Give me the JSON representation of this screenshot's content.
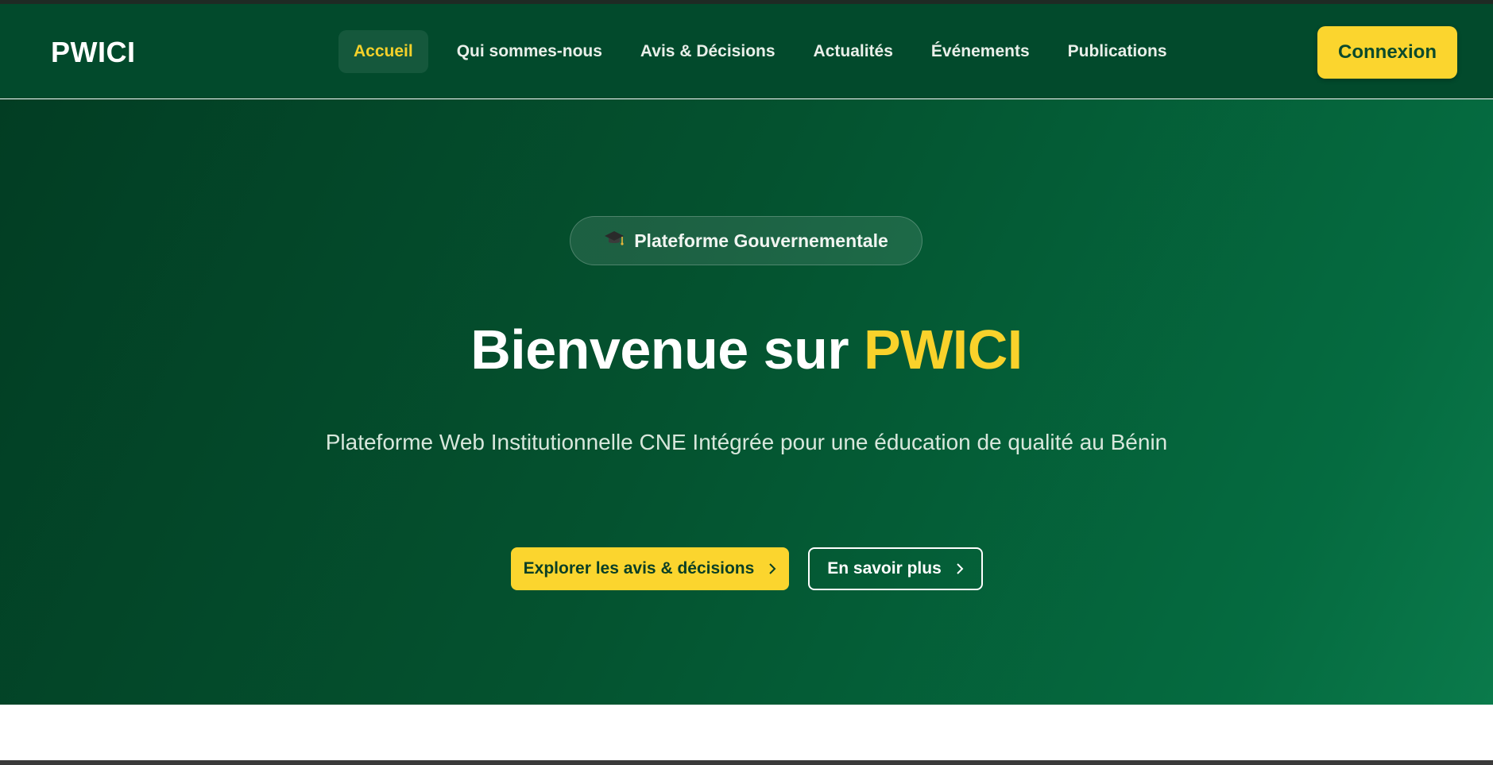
{
  "brand": {
    "logo": "PWICI"
  },
  "nav": {
    "items": [
      {
        "label": "Accueil",
        "active": true
      },
      {
        "label": "Qui sommes-nous",
        "active": false
      },
      {
        "label": "Avis & Décisions",
        "active": false
      },
      {
        "label": "Actualités",
        "active": false
      },
      {
        "label": "Événements",
        "active": false
      },
      {
        "label": "Publications",
        "active": false
      }
    ],
    "login_label": "Connexion"
  },
  "hero": {
    "badge_icon": "graduation-cap-icon",
    "badge_text": "Plateforme Gouvernementale",
    "title_prefix": "Bienvenue sur ",
    "title_accent": "PWICI",
    "subtitle": "Plateforme Web Institutionnelle CNE Intégrée pour une éducation de qualité au Bénin",
    "primary_cta": "Explorer les avis & décisions",
    "secondary_cta": "En savoir plus"
  },
  "colors": {
    "brand_green": "#024a2c",
    "accent_yellow": "#fbd52e",
    "flag_green": "#1e8a2b",
    "flag_yellow": "#f3d23c",
    "flag_red": "#d92121"
  }
}
